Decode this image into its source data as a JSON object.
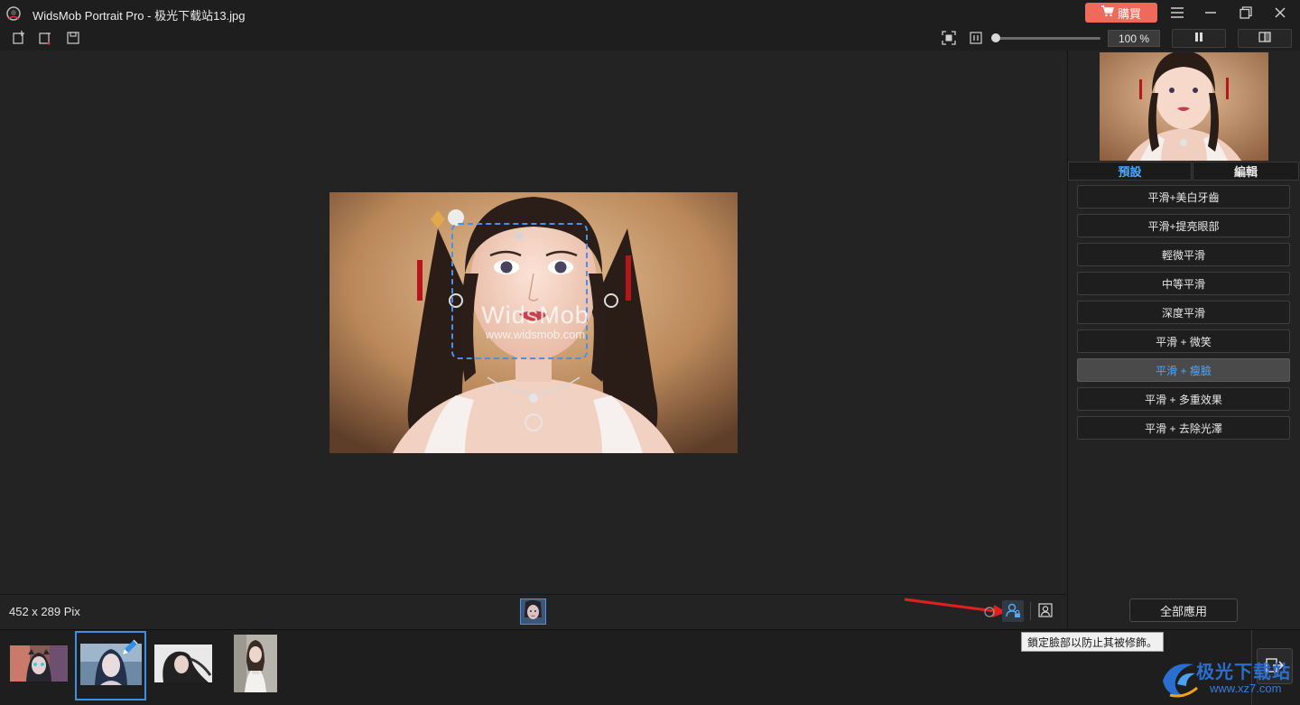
{
  "window": {
    "title": "WidsMob Portrait Pro - 极光下载站13.jpg",
    "buy_label": "購買"
  },
  "toolbar": {
    "zoom_value": "100 %",
    "zoom_level": 0.0
  },
  "canvas": {
    "watermark_title": "WidsMob",
    "watermark_url": "www.widsmob.com",
    "image_size": "452 x 289 Pix"
  },
  "right_panel": {
    "tabs": [
      {
        "label": "預設",
        "active": true
      },
      {
        "label": "編輯",
        "active": false
      }
    ],
    "presets": [
      {
        "label": "平滑+美白牙齒",
        "selected": false
      },
      {
        "label": "平滑+提亮眼部",
        "selected": false
      },
      {
        "label": "輕微平滑",
        "selected": false
      },
      {
        "label": "中等平滑",
        "selected": false
      },
      {
        "label": "深度平滑",
        "selected": false
      },
      {
        "label": "平滑 + 微笑",
        "selected": false
      },
      {
        "label": "平滑 + 瘦臉",
        "selected": true
      },
      {
        "label": "平滑 + 多重效果",
        "selected": false
      },
      {
        "label": "平滑 + 去除光澤",
        "selected": false
      }
    ],
    "apply_all_label": "全部應用"
  },
  "tooltip": "鎖定臉部以防止其被修飾。",
  "site_logo": {
    "name": "极光下载站",
    "url": "www.xz7.com"
  },
  "colors": {
    "accent": "#4ea6ff",
    "buy_button": "#ef6a5b",
    "face_box": "#4a8fe8",
    "annotation_arrow": "#e02020"
  }
}
